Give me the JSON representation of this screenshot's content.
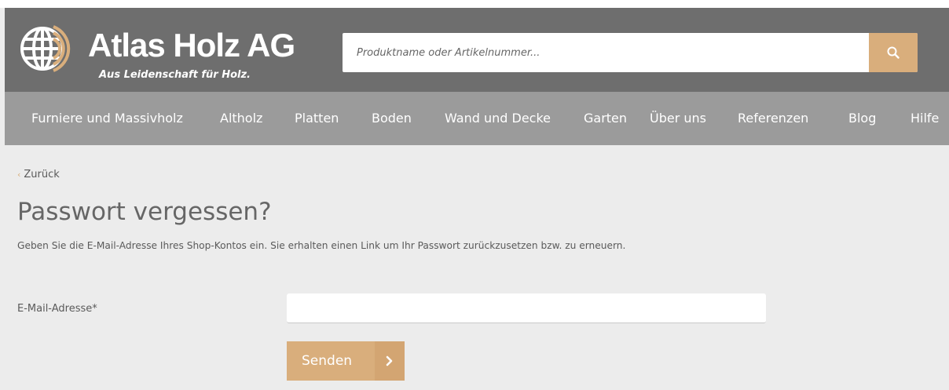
{
  "brand": {
    "name": "Atlas Holz AG",
    "tagline": "Aus Leidenschaft für Holz."
  },
  "search": {
    "placeholder": "Produktname oder Artikelnummer...",
    "value": "",
    "button_icon": "search-icon"
  },
  "nav": {
    "items": [
      "Furniere und Massivholz",
      "Altholz",
      "Platten",
      "Boden",
      "Wand und Decke",
      "Garten",
      "Über uns",
      "Referenzen",
      "Blog",
      "Hilfe"
    ]
  },
  "back": {
    "chevron": "‹",
    "label": "Zurück"
  },
  "page": {
    "title": "Passwort vergessen?",
    "description": "Geben Sie die E-Mail-Adresse Ihres  Shop-Kontos ein. Sie erhalten einen Link um Ihr Passwort zurückzusetzen bzw. zu erneuern."
  },
  "form": {
    "email_label": "E-Mail-Adresse*",
    "email_value": "",
    "submit_label": "Senden",
    "submit_icon": "chevron-right-icon"
  },
  "colors": {
    "header_bg": "#6e6e6e",
    "nav_bg": "#9b9b9b",
    "page_bg": "#ececec",
    "accent": "#d9ae7c"
  }
}
